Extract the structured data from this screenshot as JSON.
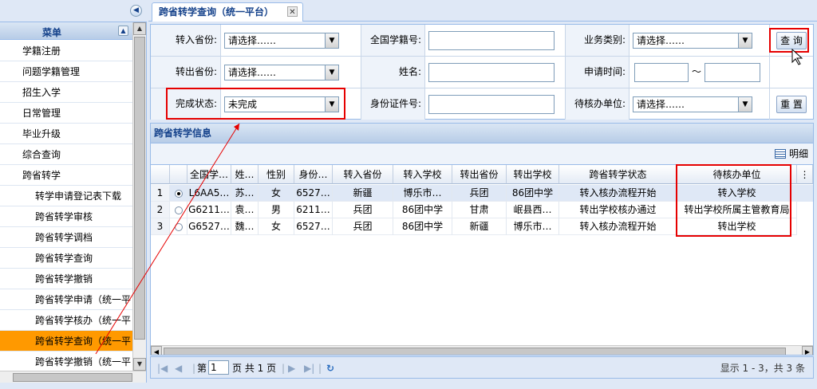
{
  "sidebar": {
    "title": "菜单",
    "items": [
      {
        "label": "学籍注册",
        "sub": false
      },
      {
        "label": "问题学籍管理",
        "sub": false
      },
      {
        "label": "招生入学",
        "sub": false
      },
      {
        "label": "日常管理",
        "sub": false
      },
      {
        "label": "毕业升级",
        "sub": false
      },
      {
        "label": "综合查询",
        "sub": false
      },
      {
        "label": "跨省转学",
        "sub": false
      },
      {
        "label": "转学申请登记表下载",
        "sub": true
      },
      {
        "label": "跨省转学审核",
        "sub": true
      },
      {
        "label": "跨省转学调档",
        "sub": true
      },
      {
        "label": "跨省转学查询",
        "sub": true
      },
      {
        "label": "跨省转学撤销",
        "sub": true
      },
      {
        "label": "跨省转学申请（统一平",
        "sub": true
      },
      {
        "label": "跨省转学核办（统一平",
        "sub": true
      },
      {
        "label": "跨省转学查询（统一平",
        "sub": true,
        "active": true
      },
      {
        "label": "跨省转学撤销（统一平",
        "sub": true
      }
    ]
  },
  "tab": {
    "label": "跨省转学查询（统一平台）"
  },
  "form": {
    "in_province_label": "转入省份:",
    "in_province_value": "请选择……",
    "out_province_label": "转出省份:",
    "out_province_value": "请选择……",
    "status_label": "完成状态:",
    "status_value": "未完成",
    "student_id_label": "全国学籍号:",
    "name_label": "姓名:",
    "id_card_label": "身份证件号:",
    "biz_type_label": "业务类别:",
    "biz_type_value": "请选择……",
    "apply_time_label": "申请时间:",
    "time_sep": "～",
    "pending_unit_label": "待核办单位:",
    "pending_unit_value": "请选择……",
    "query_button": "查 询",
    "reset_button": "重 置"
  },
  "grid": {
    "title": "跨省转学信息",
    "detail_button": "明细",
    "columns": [
      "全国学…",
      "姓…",
      "性别",
      "身份…",
      "转入省份",
      "转入学校",
      "转出省份",
      "转出学校",
      "跨省转学状态",
      "待核办单位"
    ],
    "rows": [
      {
        "no": "1",
        "selected": true,
        "cells": [
          "L6AA5…",
          "苏…",
          "女",
          "6527…",
          "新疆",
          "博乐市…",
          "兵团",
          "86团中学",
          "转入核办流程开始",
          "转入学校"
        ]
      },
      {
        "no": "2",
        "selected": false,
        "cells": [
          "G6211…",
          "袁…",
          "男",
          "6211…",
          "兵团",
          "86团中学",
          "甘肃",
          "岷县西…",
          "转出学校核办通过",
          "转出学校所属主管教育局"
        ]
      },
      {
        "no": "3",
        "selected": false,
        "cells": [
          "G6527…",
          "魏…",
          "女",
          "6527…",
          "兵团",
          "86团中学",
          "新疆",
          "博乐市…",
          "转入核办流程开始",
          "转出学校"
        ]
      }
    ]
  },
  "paging": {
    "page_prefix": "第",
    "page_value": "1",
    "page_suffix": "页 共 1 页",
    "summary": "显示 1 - 3，共 3 条"
  },
  "colors": {
    "highlight": "#ff9900",
    "annotation": "#e60000",
    "panel_border": "#99bbe8"
  }
}
